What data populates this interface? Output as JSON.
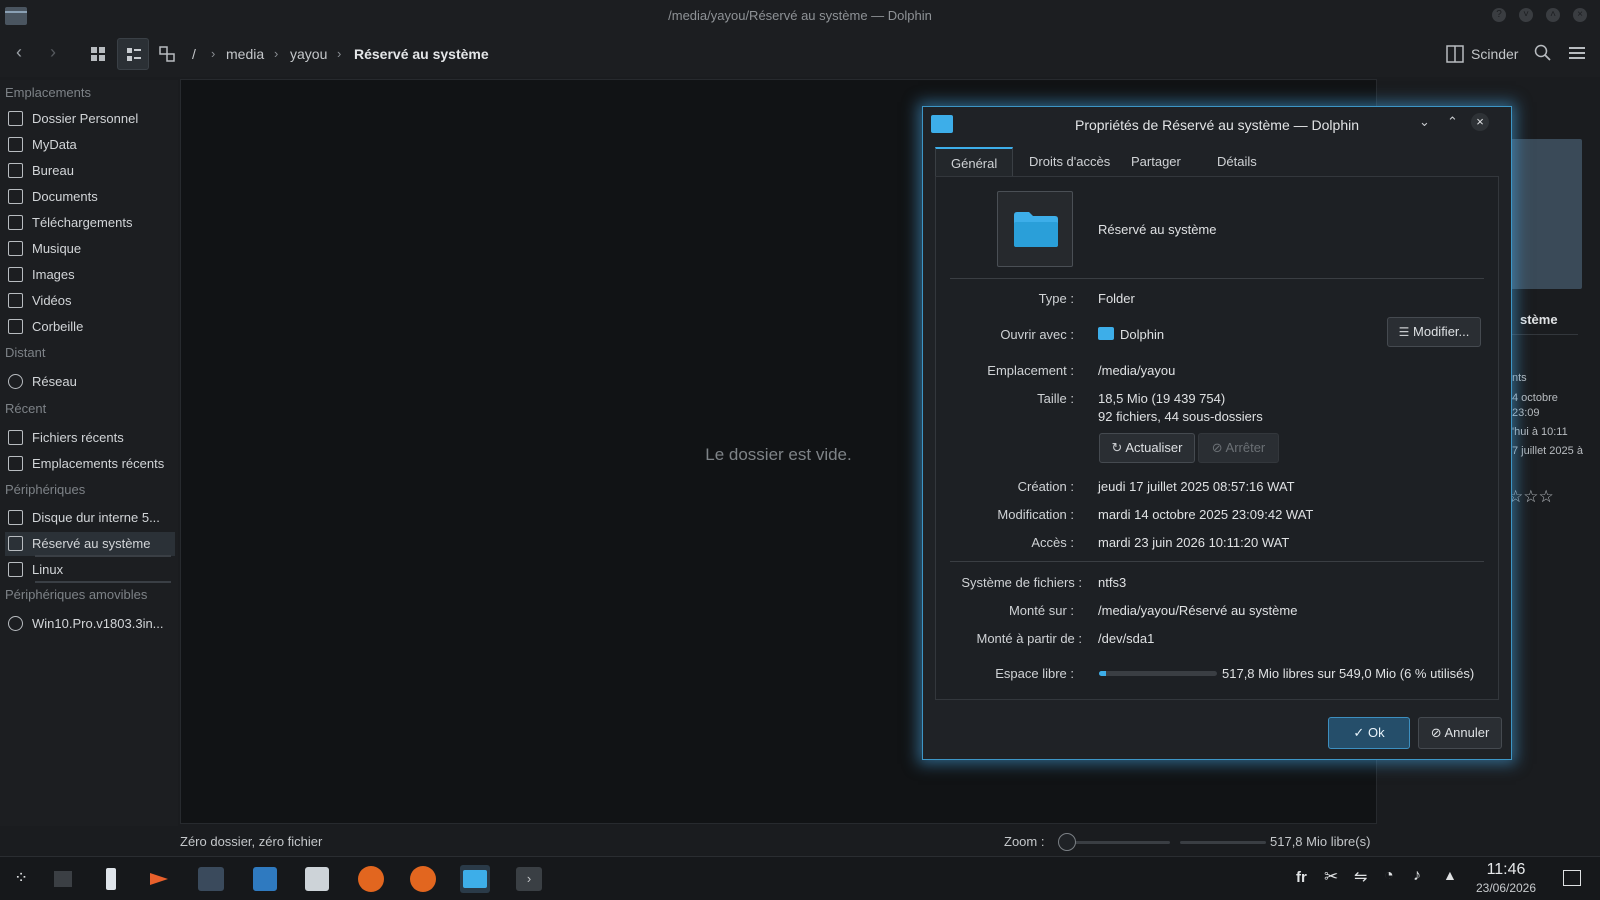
{
  "window": {
    "title": "/media/yayou/Réservé au système — Dolphin"
  },
  "toolbar": {
    "breadcrumb": [
      "/",
      "media",
      "yayou",
      "Réservé au système"
    ],
    "split_label": "Scinder"
  },
  "sidebar": {
    "sections": [
      {
        "title": "Emplacements",
        "items": [
          "Dossier Personnel",
          "MyData",
          "Bureau",
          "Documents",
          "Téléchargements",
          "Musique",
          "Images",
          "Vidéos",
          "Corbeille"
        ]
      },
      {
        "title": "Distant",
        "items": [
          "Réseau"
        ]
      },
      {
        "title": "Récent",
        "items": [
          "Fichiers récents",
          "Emplacements récents"
        ]
      },
      {
        "title": "Périphériques",
        "items": [
          "Disque dur interne 5...",
          "Réservé au système",
          "Linux"
        ]
      },
      {
        "title": "Périphériques amovibles",
        "items": [
          "Win10.Pro.v1803.3in..."
        ]
      }
    ]
  },
  "main": {
    "empty_text": "Le dossier est vide."
  },
  "info_panel": {
    "name_fragment": "stème",
    "lines": [
      "nts",
      "4 octobre",
      "23:09",
      "'hui à 10:11",
      "7 juillet 2025 à"
    ],
    "rating": "☆☆☆"
  },
  "status": {
    "summary": "Zéro dossier, zéro fichier",
    "zoom_label": "Zoom :",
    "free_space": "517,8 Mio libre(s)"
  },
  "taskbar": {
    "lang": "fr",
    "time": "11:46",
    "date": "23/06/2026"
  },
  "dialog": {
    "title": "Propriétés de Réservé au système — Dolphin",
    "tabs": [
      "Général",
      "Droits d'accès",
      "Partager",
      "Détails"
    ],
    "name": "Réservé au système",
    "type_label": "Type :",
    "type_value": "Folder",
    "open_with_label": "Ouvrir avec :",
    "open_with_value": "Dolphin",
    "modify_button": "Modifier...",
    "location_label": "Emplacement :",
    "location_value": "/media/yayou",
    "size_label": "Taille :",
    "size_value": "18,5 Mio (19 439 754)",
    "size_detail": "92 fichiers, 44 sous-dossiers",
    "refresh_button": "Actualiser",
    "stop_button": "Arrêter",
    "created_label": "Création :",
    "created_value": "jeudi 17 juillet 2025 08:57:16 WAT",
    "modified_label": "Modification :",
    "modified_value": "mardi 14 octobre 2025 23:09:42 WAT",
    "accessed_label": "Accès :",
    "accessed_value": "mardi 23 juin 2026 10:11:20 WAT",
    "fs_label": "Système de fichiers :",
    "fs_value": "ntfs3",
    "mounted_on_label": "Monté sur :",
    "mounted_on_value": "/media/yayou/Réservé au système",
    "mounted_from_label": "Monté à partir de :",
    "mounted_from_value": "/dev/sda1",
    "free_label": "Espace libre :",
    "free_value": "517,8 Mio libres sur 549,0 Mio (6 % utilisés)",
    "used_percent": 6,
    "ok_button": "Ok",
    "cancel_button": "Annuler"
  },
  "colors": {
    "accent": "#3daee9",
    "background": "#1a1c1f",
    "folder": "#3daee9"
  }
}
